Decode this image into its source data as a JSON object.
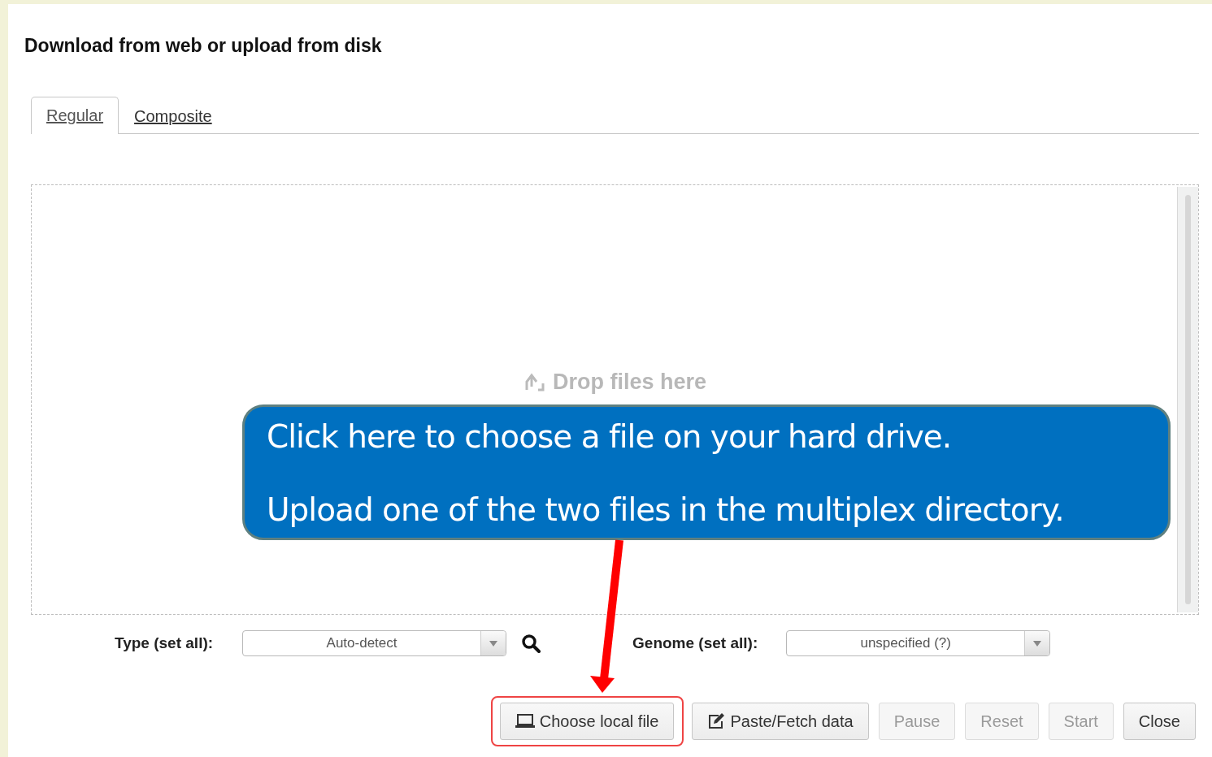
{
  "dialog": {
    "title": "Download from web or upload from disk"
  },
  "tabs": [
    {
      "label": "Regular",
      "selected": true
    },
    {
      "label": "Composite",
      "selected": false
    }
  ],
  "drop_zone": {
    "hint": "Drop files here"
  },
  "type_setting": {
    "label": "Type (set all):",
    "value": "Auto-detect"
  },
  "genome_setting": {
    "label": "Genome (set all):",
    "value": "unspecified (?)"
  },
  "buttons": [
    {
      "label": "Choose local file",
      "kind": "local",
      "disabled": false,
      "highlighted": true
    },
    {
      "label": "Paste/Fetch data",
      "kind": "paste",
      "disabled": false,
      "highlighted": false
    },
    {
      "label": "Pause",
      "kind": "plain",
      "disabled": true,
      "highlighted": false
    },
    {
      "label": "Reset",
      "kind": "plain",
      "disabled": true,
      "highlighted": false
    },
    {
      "label": "Start",
      "kind": "plain",
      "disabled": true,
      "highlighted": false
    },
    {
      "label": "Close",
      "kind": "plain",
      "disabled": false,
      "highlighted": false
    }
  ],
  "callout": {
    "lines": [
      "Click here to choose a file on your hard drive.",
      "Upload one of the two files in the multiplex directory."
    ]
  }
}
